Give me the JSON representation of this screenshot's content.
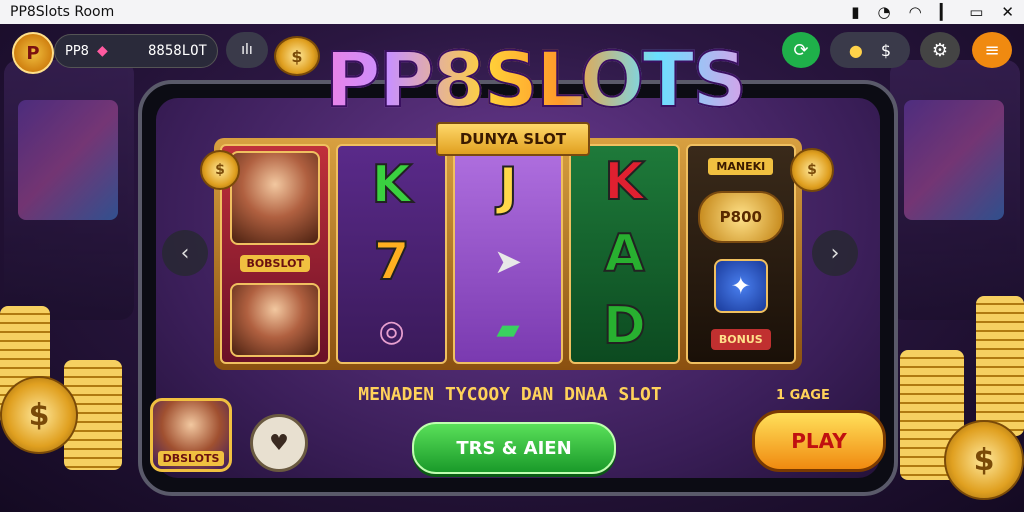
{
  "status_bar": {
    "title": "PP8Slots Room",
    "icons": [
      "nfc-icon",
      "alarm-icon",
      "wifi-icon",
      "signal-icon",
      "battery-icon",
      "close-icon"
    ]
  },
  "hud": {
    "avatar_letter": "P",
    "balance_prefix": "PP8",
    "balance_amount": "8858LOT",
    "stats_label": "ılı",
    "bulb_value": "$"
  },
  "logo": {
    "title": "PP8SLOTS",
    "subtitle": "DUNYA SLOT"
  },
  "reels": {
    "reel1": {
      "card_top_label": "",
      "card_bottom_label": "BOBSLOT"
    },
    "reel2": {
      "top": "K",
      "bottom": "7"
    },
    "reel3": {
      "top": "J"
    },
    "reel4": {
      "top": "K",
      "middle": "A",
      "bottom": "D"
    },
    "reel5": {
      "top_label": "MANEKI",
      "coin_label": "P800",
      "bottom_label": "BONUS"
    }
  },
  "tagline": "MENADEN TYCOOY DAN DNAA SLOT",
  "bet_info": "1 GAGE",
  "spin_button_label": "TRS & AIEN",
  "play_button_label": "PLAY",
  "profile_card_label": "DBSLOTS",
  "colors": {
    "accent_green": "#1fb04a",
    "accent_orange": "#f08a10",
    "gold": "#f0c040",
    "bg_purple": "#2a1640"
  }
}
